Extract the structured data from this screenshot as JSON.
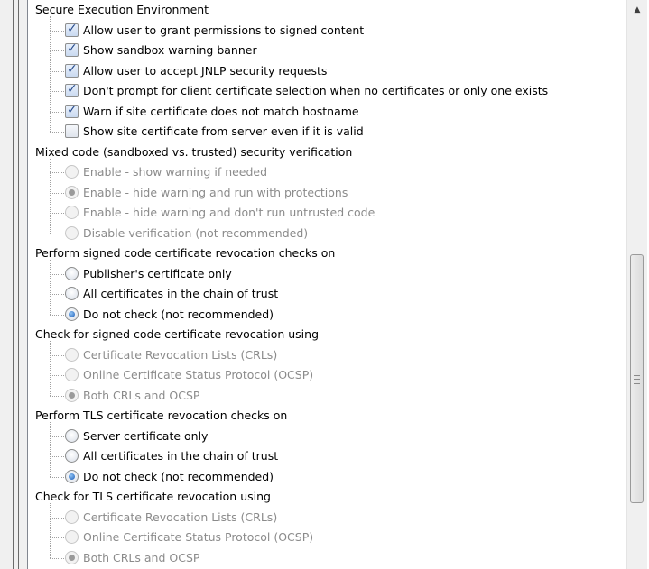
{
  "tree": {
    "groups": [
      {
        "label": "Secure Execution Environment",
        "items": [
          {
            "type": "checkbox",
            "label": "Allow user to grant permissions to signed content",
            "checked": true,
            "enabled": true
          },
          {
            "type": "checkbox",
            "label": "Show sandbox warning banner",
            "checked": true,
            "enabled": true
          },
          {
            "type": "checkbox",
            "label": "Allow user to accept JNLP security requests",
            "checked": true,
            "enabled": true
          },
          {
            "type": "checkbox",
            "label": "Don't prompt for client certificate selection when no certificates or only one exists",
            "checked": true,
            "enabled": true
          },
          {
            "type": "checkbox",
            "label": "Warn if site certificate does not match hostname",
            "checked": true,
            "enabled": true
          },
          {
            "type": "checkbox",
            "label": "Show site certificate from server even if it is valid",
            "checked": false,
            "enabled": true
          }
        ]
      },
      {
        "label": "Mixed code (sandboxed vs. trusted) security verification",
        "items": [
          {
            "type": "radio",
            "label": "Enable - show warning if needed",
            "checked": false,
            "enabled": false
          },
          {
            "type": "radio",
            "label": "Enable - hide warning and run with protections",
            "checked": true,
            "enabled": false
          },
          {
            "type": "radio",
            "label": "Enable - hide warning and don't run untrusted code",
            "checked": false,
            "enabled": false
          },
          {
            "type": "radio",
            "label": "Disable verification (not recommended)",
            "checked": false,
            "enabled": false
          }
        ]
      },
      {
        "label": "Perform signed code certificate revocation checks on",
        "items": [
          {
            "type": "radio",
            "label": "Publisher's certificate only",
            "checked": false,
            "enabled": true
          },
          {
            "type": "radio",
            "label": "All certificates in the chain of trust",
            "checked": false,
            "enabled": true
          },
          {
            "type": "radio",
            "label": "Do not check (not recommended)",
            "checked": true,
            "enabled": true
          }
        ]
      },
      {
        "label": "Check for signed code certificate revocation using",
        "items": [
          {
            "type": "radio",
            "label": "Certificate Revocation Lists (CRLs)",
            "checked": false,
            "enabled": false
          },
          {
            "type": "radio",
            "label": "Online Certificate Status Protocol (OCSP)",
            "checked": false,
            "enabled": false
          },
          {
            "type": "radio",
            "label": "Both CRLs and OCSP",
            "checked": true,
            "enabled": false
          }
        ]
      },
      {
        "label": "Perform TLS certificate revocation checks on",
        "items": [
          {
            "type": "radio",
            "label": "Server certificate only",
            "checked": false,
            "enabled": true
          },
          {
            "type": "radio",
            "label": "All certificates in the chain of trust",
            "checked": false,
            "enabled": true
          },
          {
            "type": "radio",
            "label": "Do not check (not recommended)",
            "checked": true,
            "enabled": true
          }
        ]
      },
      {
        "label": "Check for TLS certificate revocation using",
        "items": [
          {
            "type": "radio",
            "label": "Certificate Revocation Lists (CRLs)",
            "checked": false,
            "enabled": false
          },
          {
            "type": "radio",
            "label": "Online Certificate Status Protocol (OCSP)",
            "checked": false,
            "enabled": false
          },
          {
            "type": "radio",
            "label": "Both CRLs and OCSP",
            "checked": true,
            "enabled": false
          }
        ]
      }
    ]
  },
  "scrollbar": {
    "up_icon": "scroll-up-arrow-icon",
    "thumb_grip_icon": "grip-icon"
  },
  "colors": {
    "disabled_text": "#8b8b8b",
    "radio_selected": "#1a5bb5",
    "check_mark": "#2a4d8e"
  }
}
